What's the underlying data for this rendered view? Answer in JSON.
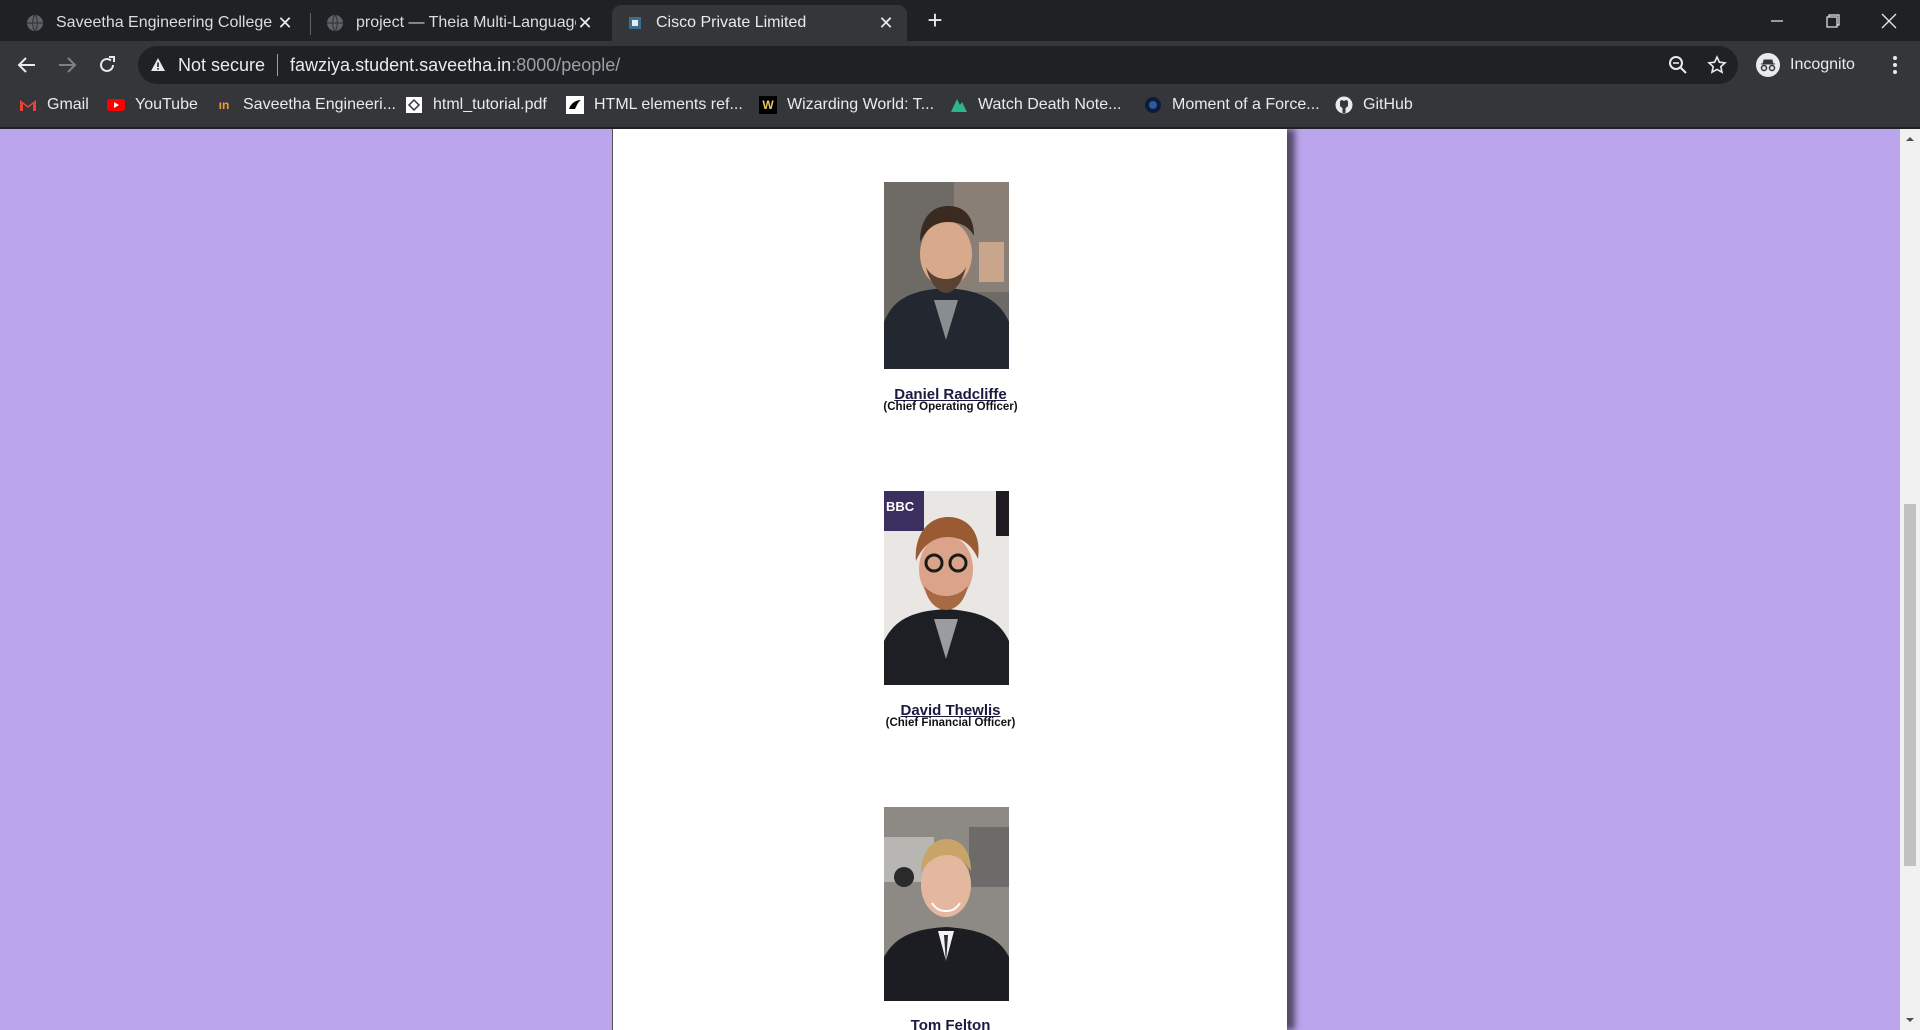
{
  "tabs": [
    {
      "title": "Saveetha Engineering College",
      "active": false
    },
    {
      "title": "project — Theia Multi-Language",
      "active": false
    },
    {
      "title": "Cisco Private Limited",
      "active": true
    }
  ],
  "toolbar": {
    "security_label": "Not secure",
    "url_host": "fawziya.student.saveetha.in",
    "url_rest": ":8000/people/",
    "profile_label": "Incognito"
  },
  "bookmarks": [
    {
      "label": "Gmail",
      "icon": "gmail-icon"
    },
    {
      "label": "YouTube",
      "icon": "youtube-icon"
    },
    {
      "label": "Saveetha Engineeri...",
      "icon": "saveetha-icon"
    },
    {
      "label": "html_tutorial.pdf",
      "icon": "pdf-icon"
    },
    {
      "label": "HTML elements ref...",
      "icon": "mdn-icon"
    },
    {
      "label": "Wizarding World: T...",
      "icon": "wizarding-icon"
    },
    {
      "label": "Watch Death Note...",
      "icon": "deathnote-icon"
    },
    {
      "label": "Moment of a Force...",
      "icon": "moment-icon"
    },
    {
      "label": "GitHub",
      "icon": "github-icon"
    }
  ],
  "people": [
    {
      "name": "Daniel Radcliffe",
      "role": "(Chief Operating Officer)"
    },
    {
      "name": "David Thewlis",
      "role": "(Chief Financial Officer)"
    },
    {
      "name": "Tom Felton",
      "role": ""
    }
  ],
  "colors": {
    "page_background": "#bba5ed",
    "content_background": "#ffffff",
    "browser_chrome": "#35363a",
    "tab_strip": "#202124"
  }
}
